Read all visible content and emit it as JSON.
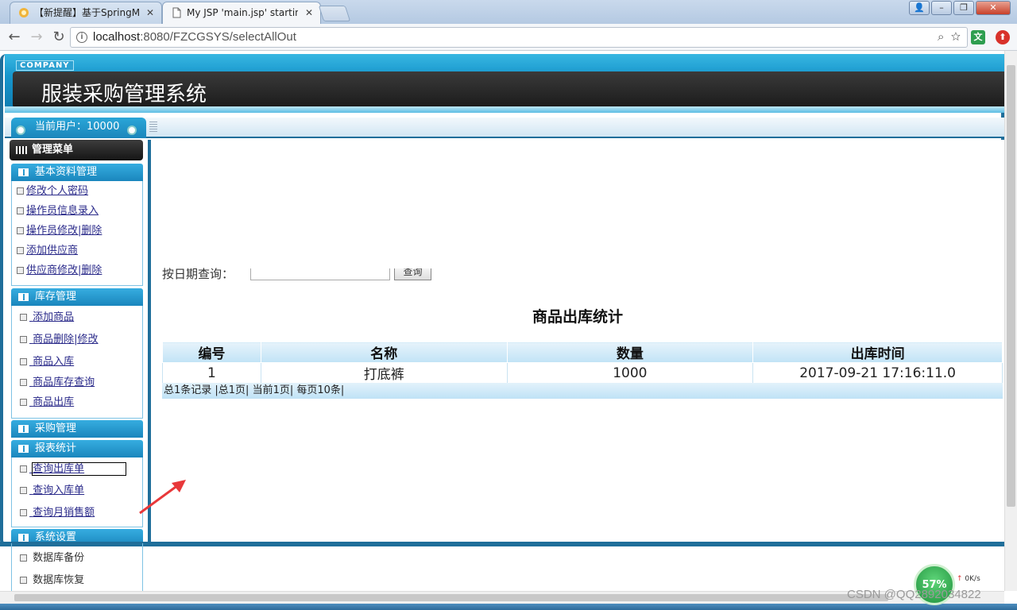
{
  "browser": {
    "tabs": [
      {
        "title": "【新提醒】基于SpringM",
        "active": false
      },
      {
        "title": "My JSP 'main.jsp' startin",
        "active": true
      }
    ],
    "url_host": "localhost",
    "url_rest": ":8080/FZCGSYS/selectAllOut"
  },
  "header": {
    "company": "COMPANY",
    "title": "服装采购管理系统",
    "current_user": "当前用户：10000"
  },
  "sidebar": {
    "menu_title": "管理菜单",
    "sections": [
      {
        "title": "基本资料管理",
        "items": [
          "修改个人密码",
          "操作员信息录入",
          "操作员修改|删除",
          "添加供应商",
          "供应商修改|删除"
        ]
      },
      {
        "title": "库存管理",
        "items": [
          "添加商品",
          "商品删除|修改",
          "商品入库",
          "商品库存查询",
          "商品出库"
        ]
      },
      {
        "title": "采购管理",
        "items": []
      },
      {
        "title": "报表统计",
        "items": [
          "查询出库单",
          "查询入库单",
          "查询月销售额"
        ]
      },
      {
        "title": "系统设置",
        "items": [
          "数据库备份",
          "数据库恢复"
        ]
      }
    ]
  },
  "content": {
    "search_label": "按日期查询：",
    "search_value": "",
    "search_button": "查询",
    "table_title": "商品出库统计",
    "columns": [
      "编号",
      "名称",
      "数量",
      "出库时间"
    ],
    "rows": [
      [
        "1",
        "打底裤",
        "1000",
        "2017-09-21 17:16:11.0"
      ]
    ],
    "pager": "总1条记录 |总1页| 当前1页| 每页10条|"
  },
  "tray": {
    "cpu": "57%",
    "net_speed": "0K/s"
  },
  "watermark": "CSDN @QQ2892034822",
  "colors": {
    "brand_blue": "#1f6e9a",
    "section_blue": "#1a86bd",
    "link": "#2a2a8a"
  }
}
